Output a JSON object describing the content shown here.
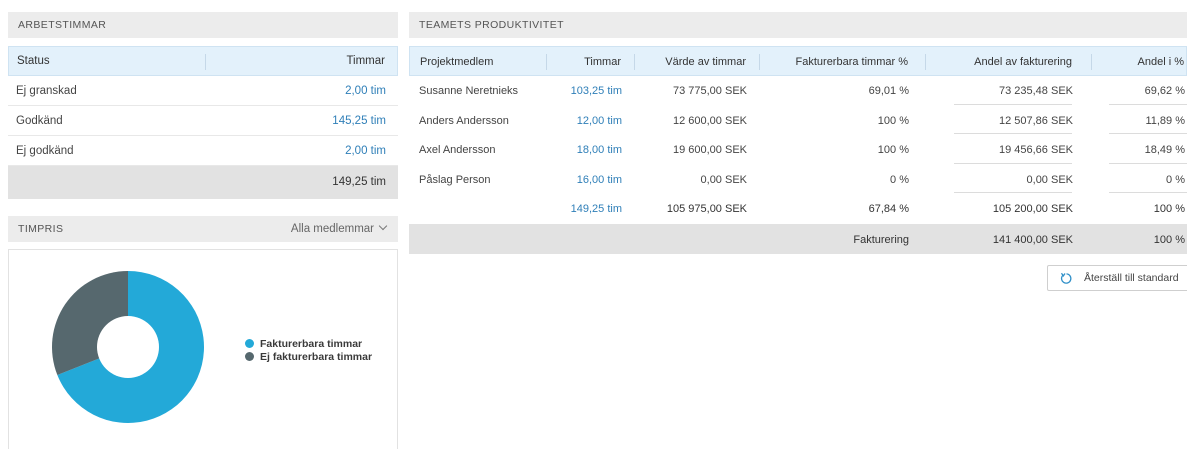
{
  "arbetstimmar": {
    "title": "ARBETSTIMMAR",
    "columns": [
      "Status",
      "Timmar"
    ],
    "rows": [
      {
        "status": "Ej granskad",
        "timmar": "2,00 tim"
      },
      {
        "status": "Godkänd",
        "timmar": "145,25 tim"
      },
      {
        "status": "Ej godkänd",
        "timmar": "2,00 tim"
      }
    ],
    "total": "149,25 tim"
  },
  "timpris": {
    "title": "TIMPRIS",
    "filter": "Alla medlemmar"
  },
  "chart_data": {
    "type": "pie",
    "labels": [
      "Fakturerbara timmar",
      "Ej fakturerbara timmar"
    ],
    "values": [
      69,
      31
    ],
    "colors": [
      "#23a9d8",
      "#56686e"
    ],
    "legend": "right"
  },
  "team": {
    "title": "TEAMETS PRODUKTIVITET",
    "columns": [
      "Projektmedlem",
      "Timmar",
      "Värde av timmar",
      "Fakturerbara timmar %",
      "Andel av fakturering",
      "Andel i %"
    ],
    "rows": [
      {
        "name": "Susanne Neretnieks",
        "timmar": "103,25 tim",
        "varde": "73 775,00 SEK",
        "fakt_pct": "69,01 %",
        "andel": "73 235,48 SEK",
        "andel_pct": "69,62 %"
      },
      {
        "name": "Anders Andersson",
        "timmar": "12,00 tim",
        "varde": "12 600,00 SEK",
        "fakt_pct": "100 %",
        "andel": "12 507,86 SEK",
        "andel_pct": "11,89 %"
      },
      {
        "name": "Axel Andersson",
        "timmar": "18,00 tim",
        "varde": "19 600,00 SEK",
        "fakt_pct": "100 %",
        "andel": "19 456,66 SEK",
        "andel_pct": "18,49 %"
      },
      {
        "name": "Påslag Person",
        "timmar": "16,00 tim",
        "varde": "0,00 SEK",
        "fakt_pct": "0 %",
        "andel": "0,00 SEK",
        "andel_pct": "0 %"
      }
    ],
    "totals": {
      "timmar": "149,25 tim",
      "varde": "105 975,00 SEK",
      "fakt_pct": "67,84 %",
      "andel": "105 200,00 SEK",
      "andel_pct": "100 %"
    },
    "fakturering": {
      "label": "Fakturering",
      "andel": "141 400,00 SEK",
      "andel_pct": "100 %"
    }
  },
  "reset_button": {
    "label": "Återställ till standard"
  }
}
